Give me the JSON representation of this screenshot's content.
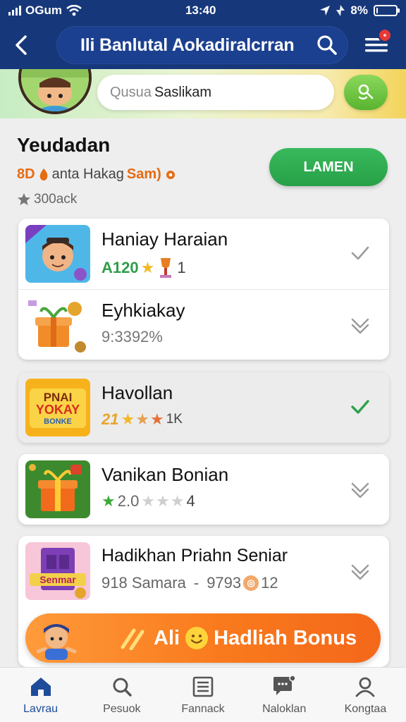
{
  "status_bar": {
    "carrier": "OGum",
    "time": "13:40",
    "battery": "8%",
    "battery_level": 0.08
  },
  "header": {
    "title": "Ili Banlutal Aokadiralcrran"
  },
  "search": {
    "placeholder": "Qusua",
    "value": "Saslikam"
  },
  "summary": {
    "title": "Yeudadan",
    "promo_prefix": "8D",
    "promo_text": "anta Hakag",
    "promo_highlight": "Sam)",
    "count": "300ack",
    "claim_label": "LAMEN"
  },
  "items": [
    {
      "name": "Haniay Haraian",
      "meta_value": "A120",
      "meta_suffix": "1",
      "checked": false
    },
    {
      "name": "Eyhkiakay",
      "meta_value": "9:3392%",
      "meta_suffix": "",
      "checked": false
    },
    {
      "name": "Havollan",
      "meta_value": "21",
      "meta_suffix": "1K",
      "checked": true
    },
    {
      "name": "Vanikan Bonian",
      "meta_value": "2.0",
      "meta_suffix": "4",
      "checked": false
    },
    {
      "name": "Hadikhan Priahn Seniar",
      "meta_value": "918 Samara",
      "meta_mid": "9793",
      "meta_suffix": "12",
      "checked": false
    }
  ],
  "thumb_labels": {
    "banner_line1": "PNAI",
    "banner_line2": "YOKAY",
    "banner_line3": "BONKE",
    "purple_label": "Senmar"
  },
  "bonus_bar": {
    "prefix": "Ali",
    "label": "Hadliah Bonus"
  },
  "bottom_nav": [
    {
      "label": "Lavrau",
      "icon": "home-icon",
      "active": true
    },
    {
      "label": "Pesuok",
      "icon": "search-icon",
      "active": false
    },
    {
      "label": "Fannack",
      "icon": "list-icon",
      "active": false
    },
    {
      "label": "Naloklan",
      "icon": "chat-icon",
      "active": false
    },
    {
      "label": "Kongtaa",
      "icon": "profile-icon",
      "active": false
    }
  ],
  "colors": {
    "header_bg": "#16377a",
    "accent_green": "#27a047",
    "accent_orange": "#f97a1d",
    "nav_active": "#1e4c9b"
  }
}
